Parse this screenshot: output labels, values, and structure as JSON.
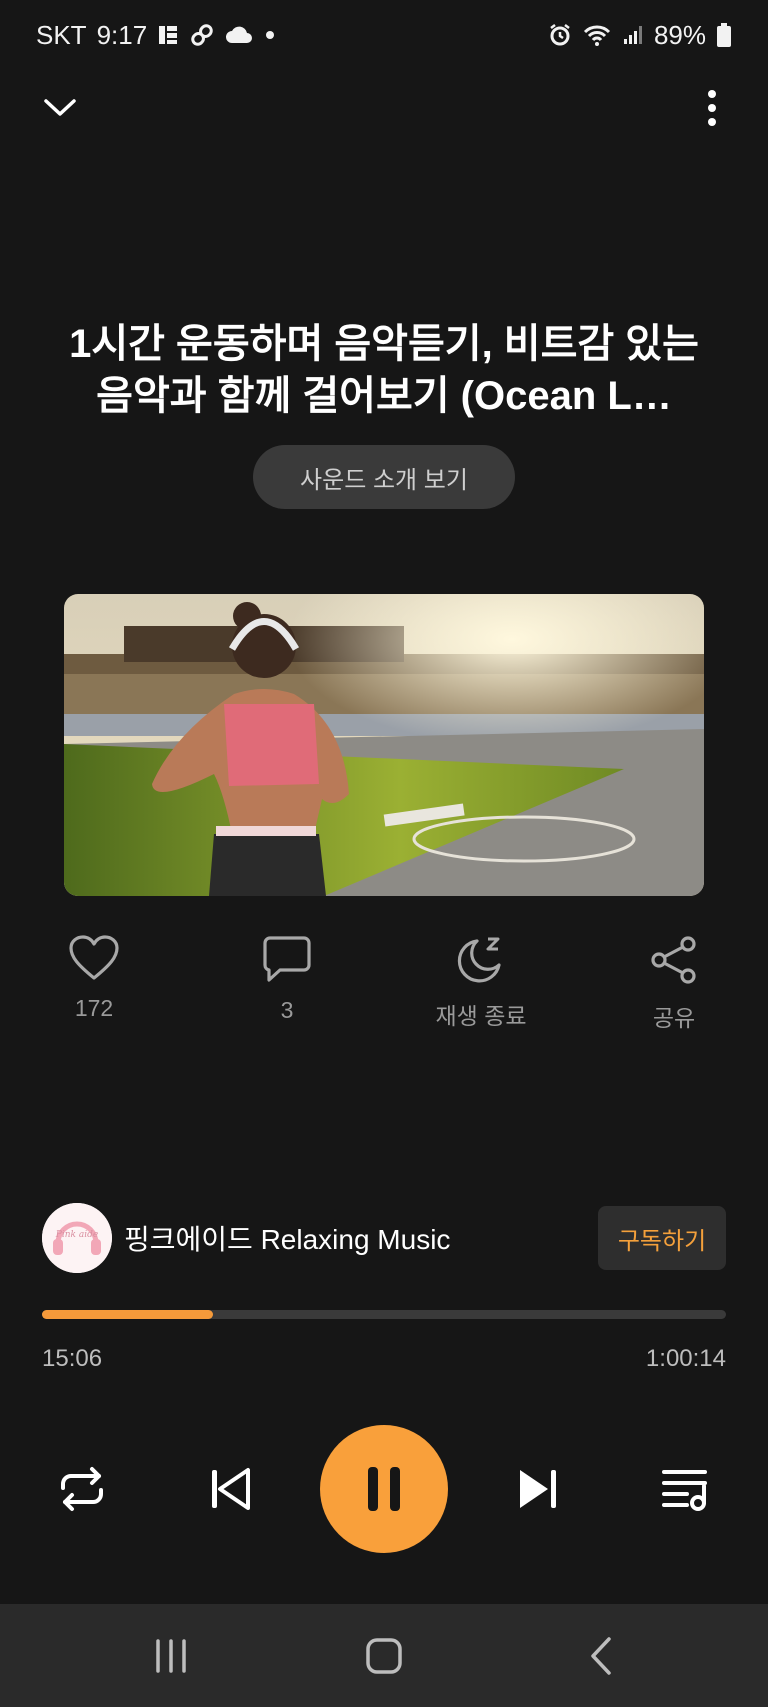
{
  "status_bar": {
    "carrier": "SKT",
    "time": "9:17",
    "battery": "89%",
    "left_icons": [
      "grid-icon",
      "link-icon",
      "cloud-icon",
      "dot-icon"
    ],
    "right_icons": [
      "alarm-icon",
      "wifi-icon",
      "signal-icon",
      "battery-icon"
    ]
  },
  "track": {
    "title": "1시간 운동하며 음악듣기, 비트감 있는 음악과 함께 걸어보기 (Ocean L…",
    "intro_button": "사운드 소개 보기"
  },
  "actions": {
    "likes": "172",
    "comments": "3",
    "sleep_timer": "재생 종료",
    "share": "공유"
  },
  "channel": {
    "name": "핑크에이드 Relaxing Music",
    "avatar_text": "Pink aide",
    "subscribe": "구독하기"
  },
  "playback": {
    "current_time": "15:06",
    "total_time": "1:00:14",
    "progress": 0.25,
    "state": "playing"
  },
  "colors": {
    "accent": "#F9A03B",
    "background": "#161616"
  }
}
